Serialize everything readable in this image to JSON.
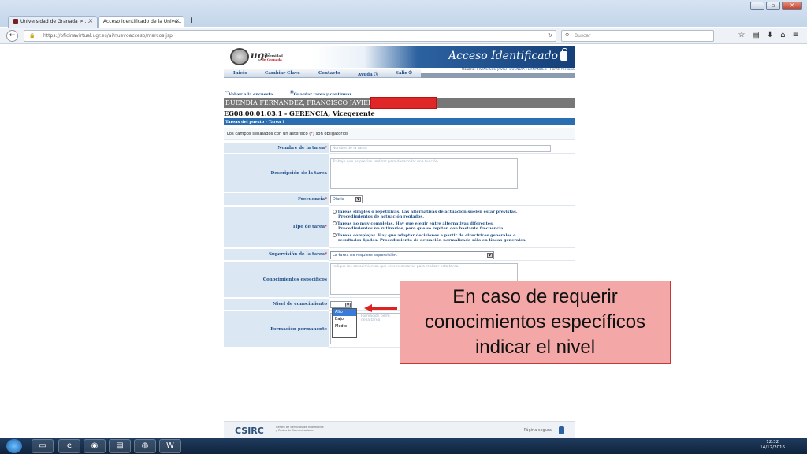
{
  "browser": {
    "tabs": [
      {
        "label": "Universidad de Granada > ...",
        "active": false
      },
      {
        "label": "Acceso identificado de la Unive...",
        "active": true
      }
    ],
    "newtab": "+",
    "url": "https://oficinavirtual.ugr.es/ai/nuevoacceso/marcos.jsp",
    "search_placeholder": "Buscar"
  },
  "header": {
    "logo_text": "ugr",
    "univ_line1": "Universidad",
    "univ_line2": "de Granada",
    "title": "Acceso Identificado",
    "user_label": "Usuario:",
    "user_name": "FRANCISCO JAVIER BUENDÍA FERNÁNDEZ",
    "profile_label": "- Perfil:",
    "profile_value": "Personal"
  },
  "menu": [
    "Inicio",
    "Cambiar Clave",
    "Contacto",
    "Ayuda ⓘ",
    "Salir ⏻"
  ],
  "actions": {
    "back": "Volver a la encuesta",
    "save": "Guardar tarea y continuar"
  },
  "person_name": "BUENDÍA FERNÁNDEZ, FRANCISCO JAVIER -",
  "position_code": "EG08.00.01.03.1 - GERENCIA, Vicegerente",
  "subheading": "Tareas del puesto - Tarea 1",
  "required_note": {
    "before": "Los campos señalados con un asterisco (",
    "asterisk": "*",
    "after": ") son obligatorios"
  },
  "form": {
    "task_name_label": "Nombre de la tarea",
    "task_name_placeholder": "Nombre de la tarea",
    "description_label": "Descripción de la tarea",
    "description_placeholder": "Trabajo que es preciso realizar para desarrollar una función.",
    "frequency_label": "Frecuencia",
    "frequency_value": "Diaria",
    "type_label": "Tipo de tarea",
    "type_options": [
      [
        "Tareas simples o repetitivas. Las alternativas de actuación suelen estar previstas.",
        "Procedimientos de actuación reglados."
      ],
      [
        "Tareas no muy complejas. Hay que elegir entre alternativas diferentes.",
        "Procedimientos no rutinarios, pero que se repiten con bastante frecuencia."
      ],
      [
        "Tareas complejas. Hay que adoptar decisiones a partir de directrices generales o",
        "resultados fijados. Procedimiento de actuación normalizado sólo en líneas generales."
      ]
    ],
    "supervision_label": "Supervisión de la tarea",
    "supervision_value": "La tarea no requiere supervisión.",
    "knowledge_label": "Conocimientos específicos",
    "knowledge_placeholder": "Indique los conocimientos que cree necesarios para realizar esta tarea",
    "level_label": "Nivel de conocimiento",
    "level_options": [
      "Alto",
      "Bajo",
      "Medio"
    ],
    "training_label": "Formación permanente",
    "training_placeholder_line1": "Formación perm",
    "training_placeholder_line2": "de la tarea"
  },
  "footer": {
    "brand": "CSIRC",
    "brand_sub1": "Centro de Servicios de Informática",
    "brand_sub2": "y Redes de Comunicaciones",
    "secure": "Página segura"
  },
  "callout": "En caso de requerir conocimientos específicos indicar el nivel",
  "taskbar": {
    "time": "12:32",
    "date": "14/12/2016"
  },
  "colors": {
    "header_blue": "#153f78",
    "label_bg": "#dbe7f2",
    "callout_bg": "#f4a7a7",
    "arrow": "#dd2222"
  }
}
